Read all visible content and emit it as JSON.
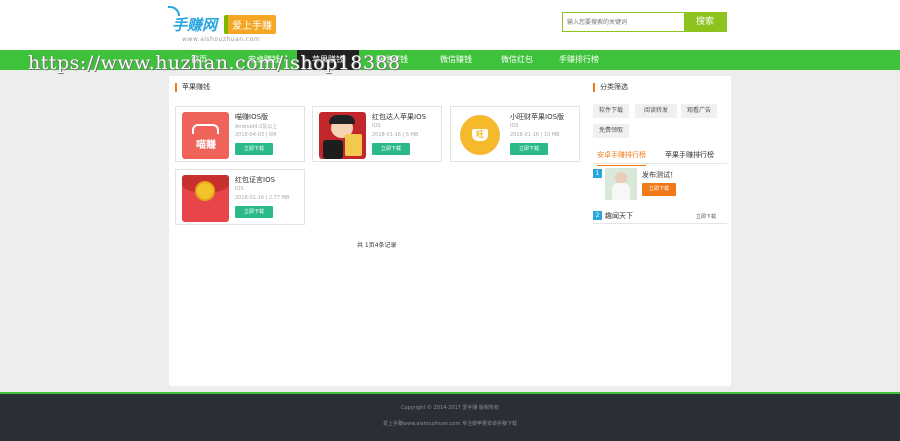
{
  "header": {
    "logo_brand": "手赚网",
    "logo_slogan": "爱上手赚",
    "logo_site": "www.aishouzhuan.com",
    "search_placeholder": "输入您要搜索的关键词",
    "search_button": "搜索"
  },
  "nav": {
    "items": [
      "首页",
      "安卓赚钱",
      "苹果赚钱",
      "网络赚钱",
      "微信赚钱",
      "微信红包",
      "手赚排行榜"
    ],
    "active_index": 2
  },
  "watermark": "https://www.huzhan.com/ishop18388",
  "main": {
    "section_title": "苹果赚钱",
    "apps": [
      {
        "name": "喵赚IOS版",
        "platform": "Android4.0及以上",
        "date_size": "2018-04-03 | 6M",
        "download": "立即下载",
        "icon": "miaozhuan-icon",
        "icon_text": "喵赚"
      },
      {
        "name": "红包达人苹果IOS",
        "platform": "IOS",
        "date_size": "2018-01-16 | 5 MB",
        "download": "立即下载",
        "icon": "hongbao-daren-icon"
      },
      {
        "name": "小旺财苹果IOS版",
        "platform": "IOS",
        "date_size": "2018-01-16 | 10 MB",
        "download": "立即下载",
        "icon": "xiaowangcai-icon",
        "icon_text": "旺"
      },
      {
        "name": "红包证言IOS",
        "platform": "IOS",
        "date_size": "2018-01-16 | 2.77 MB",
        "download": "立即下载",
        "icon": "hongbao-zhengyan-icon"
      }
    ],
    "pager": "共 1页4条记录"
  },
  "sidebar": {
    "category_title": "分类筛选",
    "tags": [
      "软件下载",
      "阅读转发",
      "观看广告",
      "免费领取"
    ],
    "tabs": [
      "安卓手赚排行榜",
      "苹果手赚排行榜"
    ],
    "active_tab": 0,
    "rank": [
      {
        "num": "1",
        "name": "发布测试！",
        "button": "立即下载"
      },
      {
        "num": "2",
        "name": "趣闻天下",
        "action": "立即下载"
      }
    ]
  },
  "footer": {
    "copyright": "Copyright © 2014-2017 爱手赚 版权所有",
    "record": "爱上手赚www.aishouzhuan.com 专注做苹果安卓手赚下载"
  },
  "colors": {
    "nav_green": "#3ec23b",
    "accent_orange": "#f07a1a",
    "download_green": "#2bb98a",
    "footer_dark": "#2a2f35",
    "brand_blue": "#2aa6df"
  }
}
